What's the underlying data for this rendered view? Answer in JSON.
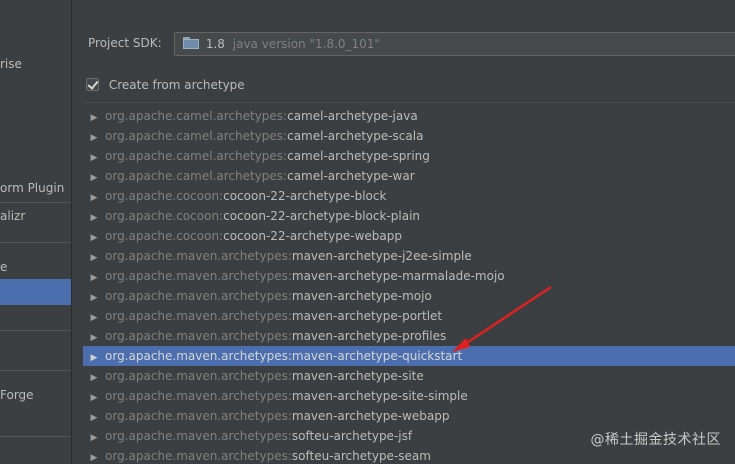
{
  "sidebar": {
    "items": [
      {
        "label": "rise",
        "selected": false
      },
      {
        "label": "orm Plugin",
        "selected": false
      },
      {
        "label": "alizr",
        "selected": false
      },
      {
        "label": "e",
        "selected": false
      },
      {
        "label": "",
        "selected": true
      },
      {
        "label": "Forge",
        "selected": false
      }
    ]
  },
  "sdk": {
    "label": "Project SDK:",
    "icon": "folder-icon",
    "version": "1.8",
    "detail": "java version \"1.8.0_101\""
  },
  "archetype_checkbox": {
    "label": "Create from archetype",
    "checked": true
  },
  "archetypes": [
    {
      "group": "org.apache.camel.archetypes:",
      "artifact": "camel-archetype-java"
    },
    {
      "group": "org.apache.camel.archetypes:",
      "artifact": "camel-archetype-scala"
    },
    {
      "group": "org.apache.camel.archetypes:",
      "artifact": "camel-archetype-spring"
    },
    {
      "group": "org.apache.camel.archetypes:",
      "artifact": "camel-archetype-war"
    },
    {
      "group": "org.apache.cocoon:",
      "artifact": "cocoon-22-archetype-block"
    },
    {
      "group": "org.apache.cocoon:",
      "artifact": "cocoon-22-archetype-block-plain"
    },
    {
      "group": "org.apache.cocoon:",
      "artifact": "cocoon-22-archetype-webapp"
    },
    {
      "group": "org.apache.maven.archetypes:",
      "artifact": "maven-archetype-j2ee-simple"
    },
    {
      "group": "org.apache.maven.archetypes:",
      "artifact": "maven-archetype-marmalade-mojo"
    },
    {
      "group": "org.apache.maven.archetypes:",
      "artifact": "maven-archetype-mojo"
    },
    {
      "group": "org.apache.maven.archetypes:",
      "artifact": "maven-archetype-portlet"
    },
    {
      "group": "org.apache.maven.archetypes:",
      "artifact": "maven-archetype-profiles"
    },
    {
      "group": "org.apache.maven.archetypes:",
      "artifact": "maven-archetype-quickstart",
      "selected": true
    },
    {
      "group": "org.apache.maven.archetypes:",
      "artifact": "maven-archetype-site"
    },
    {
      "group": "org.apache.maven.archetypes:",
      "artifact": "maven-archetype-site-simple"
    },
    {
      "group": "org.apache.maven.archetypes:",
      "artifact": "maven-archetype-webapp"
    },
    {
      "group": "org.apache.maven.archetypes:",
      "artifact": "softeu-archetype-jsf"
    },
    {
      "group": "org.apache.maven.archetypes:",
      "artifact": "softeu-archetype-seam"
    }
  ],
  "colors": {
    "background": "#3c3f41",
    "selection": "#4b6eaf",
    "annotation_arrow": "#e02020"
  },
  "watermark": "@稀土掘金技术社区"
}
